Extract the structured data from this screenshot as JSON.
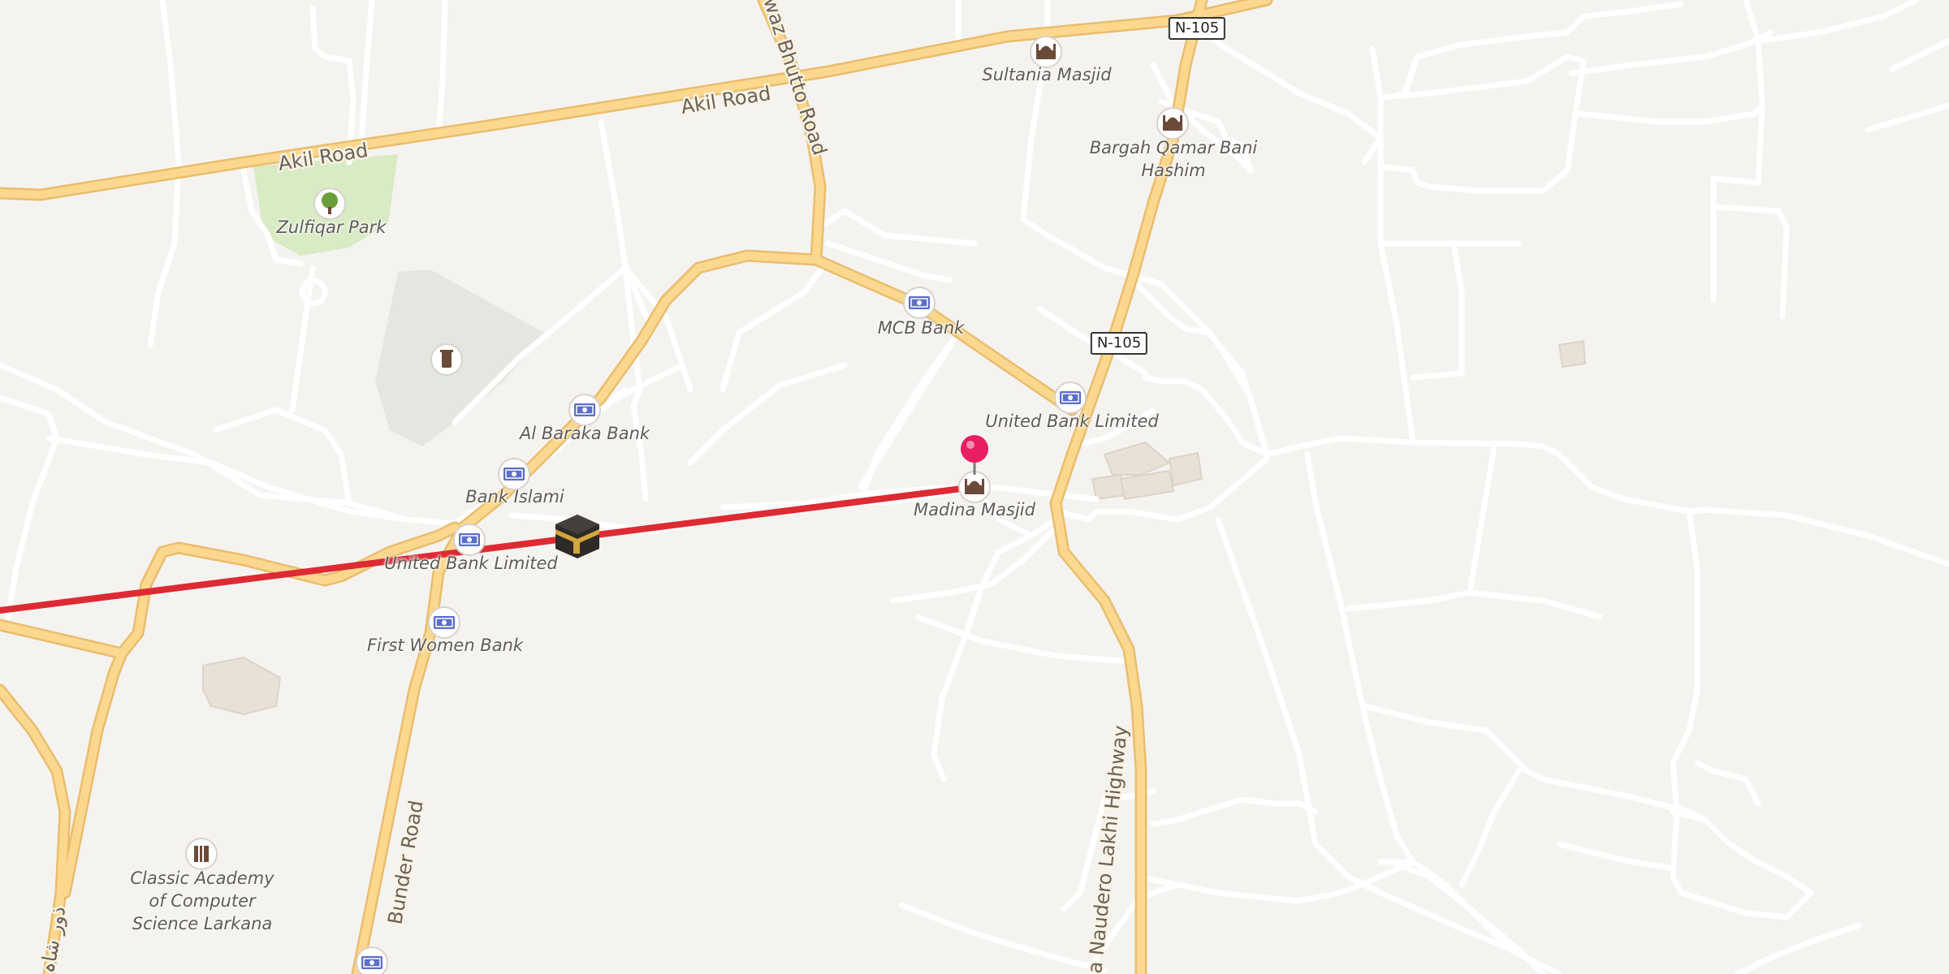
{
  "map": {
    "colors": {
      "background": "#f5f3f0",
      "minor_road": "#ffffff",
      "major_road_fill": "#fcd88e",
      "major_road_casing": "#e9bd6e",
      "park": "#d8ebc4",
      "green_area": "#e2e6de",
      "building": "#e8e1d8",
      "route_line": "#dd2a33",
      "poi_pin": "#e91e63"
    },
    "road_labels": [
      {
        "text": "Akil Road"
      },
      {
        "text": "Akil Road"
      },
      {
        "text": "waz Bhutto Road"
      },
      {
        "text": "Bunder Road"
      },
      {
        "text": "a Naudero Lakhi Highway"
      },
      {
        "text": "ذور شاہ"
      }
    ],
    "shields": [
      {
        "text": "N-105"
      },
      {
        "text": "N-105"
      }
    ],
    "pois": [
      {
        "label": "Sultania Masjid",
        "icon": "mosque-icon"
      },
      {
        "label": "Bargah Qamar Bani Hashim",
        "icon": "mosque-icon"
      },
      {
        "label": "Zulfiqar Park",
        "icon": "tree-icon"
      },
      {
        "label": "MCB Bank",
        "icon": "bank-icon"
      },
      {
        "label": "United Bank Limited",
        "icon": "bank-icon"
      },
      {
        "label": "Al Baraka Bank",
        "icon": "bank-icon"
      },
      {
        "label": "Bank Islami",
        "icon": "bank-icon"
      },
      {
        "label": "Madina Masjid",
        "icon": "mosque-icon"
      },
      {
        "label": "United Bank Limited",
        "icon": "bank-icon"
      },
      {
        "label": "First Women Bank",
        "icon": "bank-icon"
      },
      {
        "label": "Classic Academy of Computer Science Larkana",
        "icon": "school-icon"
      },
      {
        "label": "",
        "icon": "cemetery-icon"
      },
      {
        "label": "",
        "icon": "bank-icon"
      }
    ],
    "markers": {
      "pin": {
        "name": "location-pin-icon"
      },
      "kaaba": {
        "name": "kaaba-icon"
      }
    }
  }
}
